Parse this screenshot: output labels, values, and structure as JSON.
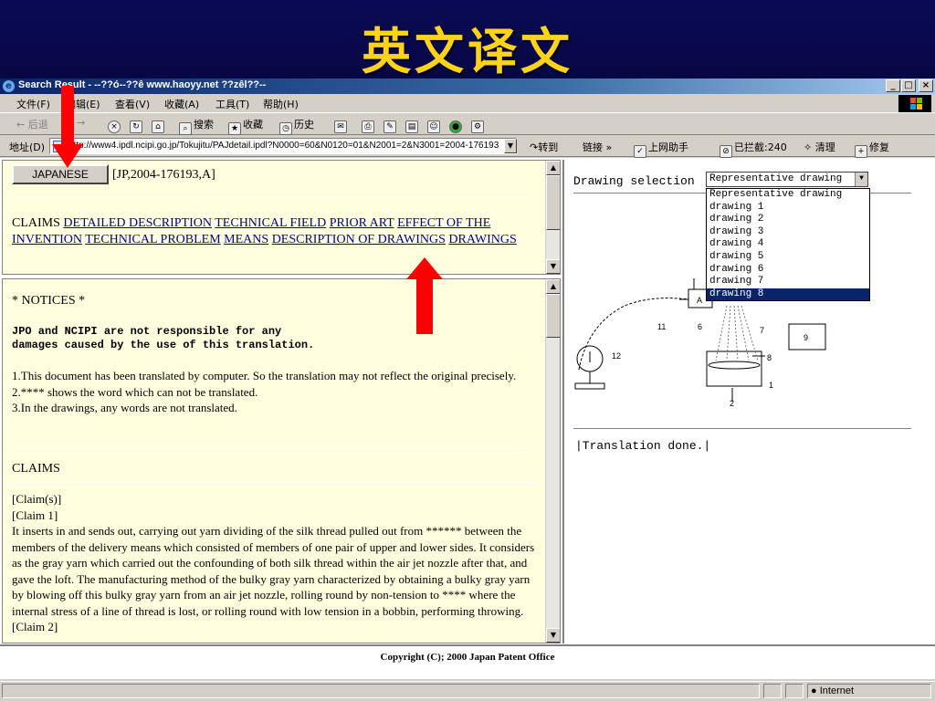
{
  "slide": {
    "title": "英文译文"
  },
  "window": {
    "title": "Search Result - --??ó--??ê www.haoyy.net ??zêl??--",
    "min_glyph": "_",
    "max_glyph": "□",
    "close_glyph": "×"
  },
  "menu": {
    "items": [
      "文件(F)",
      "编辑(E)",
      "查看(V)",
      "收藏(A)",
      "工具(T)",
      "帮助(H)"
    ]
  },
  "toolbar": {
    "back": "← 后退",
    "forward": "→",
    "search": "搜索",
    "favorites": "收藏",
    "history": "历史"
  },
  "address": {
    "label": "地址(D)",
    "url": "http://www4.ipdl.ncipi.go.jp/Tokujitu/PAJdetail.ipdl?N0000=60&N0120=01&N2001=2&N3001=2004-176193",
    "go": "转到",
    "links": "链接",
    "assistant": "上网助手",
    "blocked": "已拦截:240",
    "clean": "清理",
    "repair": "修复"
  },
  "top_frame": {
    "japanese_button": "JAPANESE",
    "doc_id": "[JP,2004-176193,A]",
    "claims_label": "CLAIMS",
    "links": [
      "DETAILED DESCRIPTION",
      "TECHNICAL FIELD",
      "PRIOR ART",
      "EFFECT OF THE INVENTION",
      "TECHNICAL PROBLEM",
      "MEANS",
      "DESCRIPTION OF DRAWINGS",
      "DRAWINGS"
    ]
  },
  "bottom_frame": {
    "notices_title": "* NOTICES *",
    "disclaimer": [
      "JPO and NCIPI are not responsible for any",
      "damages caused by the use of this translation."
    ],
    "notes": [
      "1.This document has been translated by computer. So the translation may not reflect the original precisely.",
      "2.**** shows the word which can not be translated.",
      "3.In the drawings, any words are not translated."
    ],
    "claims_heading": "CLAIMS",
    "claims_label": "[Claim(s)]",
    "claim1_label": "[Claim 1]",
    "claim1_text": "It inserts in and sends out, carrying out yarn dividing of the silk thread pulled out from ****** between the members of the delivery means which consisted of members of one pair of upper and lower sides. It considers as the gray yarn which carried out the confounding of both silk thread within the air jet nozzle after that, and gave the loft. The manufacturing method of the bulky gray yarn characterized by obtaining a bulky gray yarn by blowing off this bulky gray yarn from an air jet nozzle, rolling round by non-tension to **** where the internal stress of a line of thread is lost, or rolling round with low tension in a bobbin, performing throwing.",
    "claim2_label": "[Claim 2]"
  },
  "right_frame": {
    "drawing_label": "Drawing selection",
    "selected": "Representative drawing",
    "options": [
      "Representative drawing",
      "drawing 1",
      "drawing 2",
      "drawing 3",
      "drawing 4",
      "drawing 5",
      "drawing 6",
      "drawing 7",
      "drawing 8"
    ],
    "highlighted_index": 8,
    "status": "|Translation done.|",
    "drawing_labels": {
      "a": "A",
      "n11": "11",
      "n12": "12",
      "n6": "6",
      "n7": "7",
      "n8": "8",
      "n2": "2",
      "n1": "1",
      "n9": "9"
    }
  },
  "footer": {
    "copyright": "Copyright (C); 2000 Japan Patent Office"
  },
  "statusbar": {
    "zone": "Internet"
  },
  "colors": {
    "banner_bg": "#0a0a55",
    "banner_title": "#ffd21c",
    "frame_bg": "#ffffe0",
    "link": "#00008b",
    "arrow": "#ff0000",
    "highlight": "#0a246a"
  }
}
